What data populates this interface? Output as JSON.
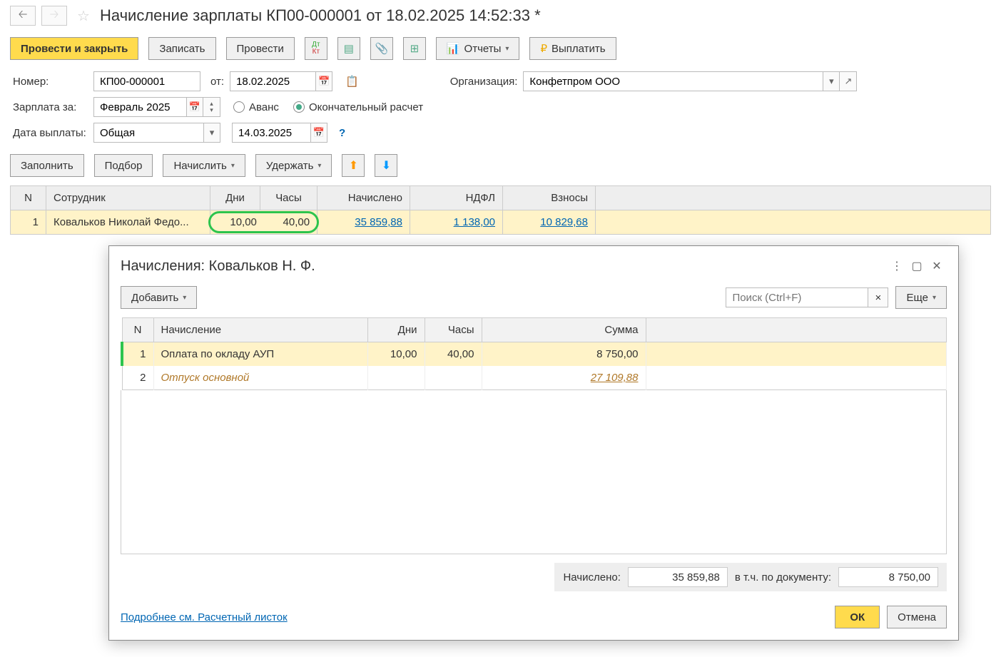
{
  "header": {
    "title": "Начисление зарплаты КП00-000001 от 18.02.2025 14:52:33 *"
  },
  "toolbar": {
    "post_close": "Провести и закрыть",
    "save": "Записать",
    "post": "Провести",
    "reports": "Отчеты",
    "pay": "Выплатить"
  },
  "form": {
    "number_label": "Номер:",
    "number": "КП00-000001",
    "from_label": "от:",
    "date": "18.02.2025",
    "org_label": "Организация:",
    "org": "Конфетпром ООО",
    "salary_for_label": "Зарплата за:",
    "salary_for": "Февраль 2025",
    "advance": "Аванс",
    "final": "Окончательный расчет",
    "pay_date_label": "Дата выплаты:",
    "pay_date_type": "Общая",
    "pay_date": "14.03.2025"
  },
  "actions": {
    "fill": "Заполнить",
    "pick": "Подбор",
    "accrue": "Начислить",
    "withhold": "Удержать"
  },
  "main_table": {
    "headers": {
      "n": "N",
      "emp": "Сотрудник",
      "days": "Дни",
      "hours": "Часы",
      "accrued": "Начислено",
      "ndfl": "НДФЛ",
      "contrib": "Взносы"
    },
    "rows": [
      {
        "n": "1",
        "emp": "Ковальков Николай Федо...",
        "days": "10,00",
        "hours": "40,00",
        "accrued": "35 859,88",
        "ndfl": "1 138,00",
        "contrib": "10 829,68"
      }
    ]
  },
  "modal": {
    "title": "Начисления: Ковальков Н. Ф.",
    "add": "Добавить",
    "search_placeholder": "Поиск (Ctrl+F)",
    "more": "Еще",
    "headers": {
      "n": "N",
      "accrual": "Начисление",
      "days": "Дни",
      "hours": "Часы",
      "sum": "Сумма"
    },
    "rows": [
      {
        "n": "1",
        "name": "Оплата по окладу АУП",
        "days": "10,00",
        "hours": "40,00",
        "sum": "8 750,00",
        "italic": false
      },
      {
        "n": "2",
        "name": "Отпуск основной",
        "days": "",
        "hours": "",
        "sum": "27 109,88",
        "italic": true
      }
    ],
    "accrued_label": "Начислено:",
    "accrued_value": "35 859,88",
    "doc_label": "в т.ч. по документу:",
    "doc_value": "8 750,00",
    "more_link": "Подробнее см. Расчетный листок",
    "ok": "ОК",
    "cancel": "Отмена"
  }
}
